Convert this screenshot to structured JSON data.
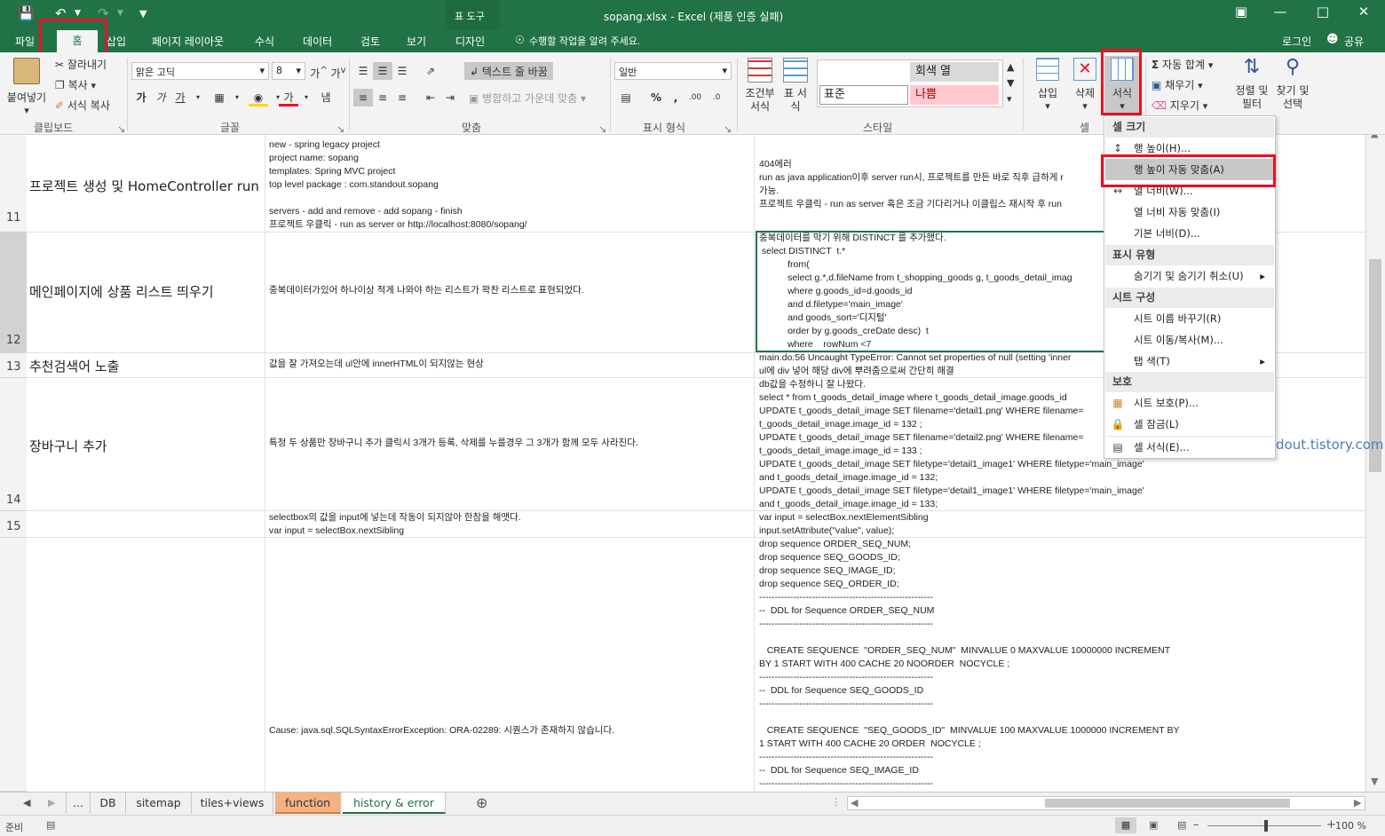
{
  "window": {
    "title": "sopang.xlsx - Excel (제품 인증 실패)",
    "tool_group": "표 도구",
    "login": "로그인",
    "share": "공유"
  },
  "tabs": [
    "파일",
    "홈",
    "삽입",
    "페이지 레이아웃",
    "수식",
    "데이터",
    "검토",
    "보기",
    "디자인"
  ],
  "tell_me": "수행할 작업을 알려 주세요.",
  "ribbon": {
    "clipboard": {
      "paste": "붙여넣기",
      "cut": "잘라내기",
      "copy": "복사",
      "format_painter": "서식 복사",
      "label": "클립보드"
    },
    "font": {
      "name": "맑은 고딕",
      "size": "8",
      "label": "글꼴"
    },
    "align": {
      "wrap": "텍스트 줄 바꿈",
      "merge": "병합하고 가운데 맞춤",
      "label": "맞춤"
    },
    "number": {
      "format": "일반",
      "label": "표시 형식"
    },
    "styles": {
      "cond": "조건부 서식",
      "table": "표 서식",
      "s1": "회색 열",
      "s2": "표준",
      "s3": "나쁨",
      "label": "스타일"
    },
    "cells": {
      "insert": "삽입",
      "delete": "삭제",
      "format": "서식",
      "label": "셀"
    },
    "editing": {
      "autosum": "자동 합계",
      "fill": "채우기",
      "clear": "지우기",
      "sort": "정렬 및 필터",
      "find": "찾기 및 선택"
    }
  },
  "rows": [
    {
      "num": "11",
      "title": "프로젝트 생성 및 HomeController run",
      "desc": "new - spring legacy project\nproject name: sopang\ntemplates: Spring MVC project\ntop level package : com.standout.sopang\n\nservers - add and remove - add sopang - finish\n프로젝트 우클릭 - run as server or http://localhost:8080/sopang/",
      "sol": "404에러\nrun as java application이후 server run시, 프로젝트를 만든 바로 직후 급하게 r\n가능.\n프로젝트 우클릭 - run as server 혹은 조금 기다리거나 이클립스 재시작 후 run"
    },
    {
      "num": "12",
      "title": "메인페이지에 상품 리스트 띄우기",
      "desc": "중복데이터가있어 하나이상 적게 나와야 하는 리스트가 꽉찬 리스트로 표현되었다.",
      "sol": "중복데이터를 막기 위해 DISTINCT 를 추가했다.\n select DISTINCT  t.*\n           from(\n           select g.*,d.fileName from t_shopping_goods g, t_goods_detail_imag\n           where g.goods_id=d.goods_id\n           and d.filetype='main_image'\n           and goods_sort='디지털'\n           order by g.goods_creDate desc)  t\n           where    rowNum <7"
    },
    {
      "num": "13",
      "title": "추천검색어 노출",
      "desc": "값을 잘 가져오는데 ul안에 innerHTML이 되지않는 현상",
      "sol": "main.do:56 Uncaught TypeError: Cannot set properties of null (setting 'inner\nul에 div 넣어 해당 div에 뿌려줌으로써 간단히 해결"
    },
    {
      "num": "14",
      "title": "장바구니 추가",
      "desc": "특정 두 상품만 장바구니 추가 클릭시 3개가 등록, 삭제를 누를경우 그 3개가 함께 모두 사라진다.",
      "sol": "db값을 수정하니 잘 나왔다.\nselect * from t_goods_detail_image where t_goods_detail_image.goods_id\nUPDATE t_goods_detail_image SET filename='detail1.png' WHERE filename=\nt_goods_detail_image.image_id = 132 ;\nUPDATE t_goods_detail_image SET filename='detail2.png' WHERE filename=\nt_goods_detail_image.image_id = 133 ;\nUPDATE t_goods_detail_image SET filetype='detail1_image1' WHERE filetype='main_image'\nand t_goods_detail_image.image_id = 132;\nUPDATE t_goods_detail_image SET filetype='detail1_image1' WHERE filetype='main_image'\nand t_goods_detail_image.image_id = 133;",
      "link": "dout.tistory.com"
    },
    {
      "num": "15",
      "title": "",
      "desc": "selectbox의 값을 input에 넣는데 작동이 되지않아 한참을 해맷다.\nvar input = selectBox.nextSibling",
      "sol": "var input = selectBox.nextElementSibling\ninput.setAttribute(\"value\", value);"
    },
    {
      "num": "",
      "title": "",
      "desc": "Cause: java.sql.SQLSyntaxErrorException: ORA-02289: 시퀀스가 존재하지 않습니다.",
      "sol": "drop sequence ORDER_SEQ_NUM;\ndrop sequence SEQ_GOODS_ID;\ndrop sequence SEQ_IMAGE_ID;\ndrop sequence SEQ_ORDER_ID;\n--------------------------------------------------------\n--  DDL for Sequence ORDER_SEQ_NUM\n--------------------------------------------------------\n\n   CREATE SEQUENCE  \"ORDER_SEQ_NUM\"  MINVALUE 0 MAXVALUE 10000000 INCREMENT\nBY 1 START WITH 400 CACHE 20 NOORDER  NOCYCLE ;\n--------------------------------------------------------\n--  DDL for Sequence SEQ_GOODS_ID\n--------------------------------------------------------\n\n   CREATE SEQUENCE  \"SEQ_GOODS_ID\"  MINVALUE 100 MAXVALUE 1000000 INCREMENT BY\n1 START WITH 400 CACHE 20 ORDER  NOCYCLE ;\n--------------------------------------------------------\n--  DDL for Sequence SEQ_IMAGE_ID\n--------------------------------------------------------"
    }
  ],
  "menu": {
    "h1": "셀 크기",
    "i1": "행 높이(H)...",
    "i2": "행 높이 자동 맞춤(A)",
    "i3": "열 너비(W)...",
    "i4": "열 너비 자동 맞춤(I)",
    "i5": "기본 너비(D)...",
    "h2": "표시 유형",
    "i6": "숨기기 및 숨기기 취소(U)",
    "h3": "시트 구성",
    "i7": "시트 이름 바꾸기(R)",
    "i8": "시트 이동/복사(M)...",
    "i9": "탭 색(T)",
    "h4": "보호",
    "i10": "시트 보호(P)...",
    "i11": "셀 잠금(L)",
    "i12": "셀 서식(E)..."
  },
  "sheets": {
    "more": "...",
    "s1": "DB",
    "s2": "sitemap",
    "s3": "tiles+views",
    "s4": "function",
    "s5": "history & error"
  },
  "status": {
    "ready": "준비",
    "zoom": "100 %"
  },
  "colors": {
    "excel_green": "#217346",
    "highlight_red": "#e81123",
    "function_tab": "#f4b183"
  }
}
